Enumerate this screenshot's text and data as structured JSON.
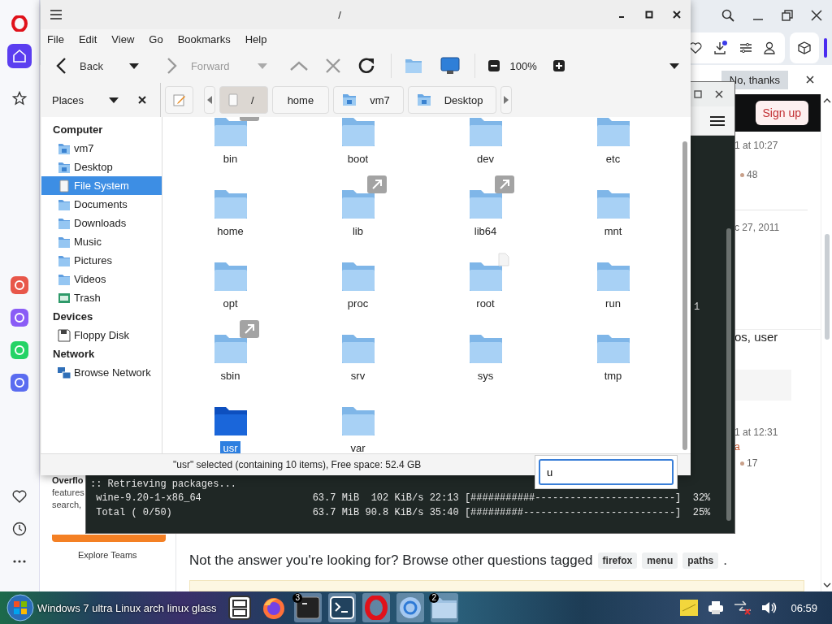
{
  "browser": {
    "sidebar": [
      {
        "kind": "logo",
        "selected": false
      },
      {
        "kind": "home",
        "selected": true
      },
      {
        "kind": "star",
        "selected": false
      },
      {
        "kind": "app-photos",
        "selected": false
      },
      {
        "kind": "app-messenger",
        "selected": false
      },
      {
        "kind": "app-whatsapp",
        "selected": false
      },
      {
        "kind": "app-music",
        "selected": false
      },
      {
        "kind": "heart",
        "selected": false
      },
      {
        "kind": "history",
        "selected": false
      },
      {
        "kind": "more",
        "selected": false
      }
    ],
    "banner": {
      "dismiss": "No, thanks"
    },
    "header": {
      "signup": "Sign up"
    },
    "side_fragments": [
      {
        "kind": "meta",
        "text": "1 at 10:27"
      },
      {
        "kind": "score",
        "text": "48"
      },
      {
        "kind": "meta",
        "text": "c 27, 2011"
      },
      {
        "kind": "title",
        "text": "os, user"
      },
      {
        "kind": "meta",
        "text": "1 at 12:31"
      },
      {
        "kind": "author",
        "text": "a"
      },
      {
        "kind": "score",
        "text": "17"
      }
    ],
    "promo": {
      "lines": [
        "Overflo",
        "features",
        "search,"
      ],
      "link": "Explore Teams"
    },
    "footer_question": {
      "text": "Not the answer you're looking for? Browse other questions tagged",
      "tags": [
        "firefox",
        "menu",
        "paths"
      ],
      "end": "."
    }
  },
  "terminal": {
    "fragment": "1",
    "lines": [
      ":: Retrieving packages...",
      " wine-9.20-1-x86_64                   63.7 MiB  102 KiB/s 22:13 [###########------------------------]  32%",
      " Total ( 0/50)                        63.7 MiB 90.8 KiB/s 35:40 [#########--------------------------]  25%"
    ]
  },
  "file_manager": {
    "title": "/",
    "menu": [
      "File",
      "Edit",
      "View",
      "Go",
      "Bookmarks",
      "Help"
    ],
    "toolbar": {
      "back": "Back",
      "forward": "Forward",
      "forward_disabled": true,
      "zoom": "100%"
    },
    "places_label": "Places",
    "path": [
      {
        "label": "/",
        "kind": "root",
        "selected": true
      },
      {
        "label": "home",
        "kind": "plain",
        "selected": false
      },
      {
        "label": "vm7",
        "kind": "home",
        "selected": false
      },
      {
        "label": "Desktop",
        "kind": "desktop",
        "selected": false
      }
    ],
    "sidebar": [
      {
        "heading": "Computer",
        "items": [
          {
            "label": "vm7",
            "kind": "home",
            "selected": false
          },
          {
            "label": "Desktop",
            "kind": "desktop",
            "selected": false
          },
          {
            "label": "File System",
            "kind": "filesystem",
            "selected": true
          },
          {
            "label": "Documents",
            "kind": "folder",
            "selected": false
          },
          {
            "label": "Downloads",
            "kind": "folder",
            "selected": false
          },
          {
            "label": "Music",
            "kind": "folder",
            "selected": false
          },
          {
            "label": "Pictures",
            "kind": "folder",
            "selected": false
          },
          {
            "label": "Videos",
            "kind": "folder",
            "selected": false
          },
          {
            "label": "Trash",
            "kind": "trash",
            "selected": false
          }
        ]
      },
      {
        "heading": "Devices",
        "items": [
          {
            "label": "Floppy Disk",
            "kind": "floppy",
            "selected": false
          }
        ]
      },
      {
        "heading": "Network",
        "items": [
          {
            "label": "Browse Network",
            "kind": "network",
            "selected": false
          }
        ]
      }
    ],
    "files": [
      {
        "name": "bin",
        "kind": "symlink",
        "selected": false
      },
      {
        "name": "boot",
        "kind": "folder",
        "selected": false
      },
      {
        "name": "dev",
        "kind": "folder",
        "selected": false
      },
      {
        "name": "etc",
        "kind": "folder",
        "selected": false
      },
      {
        "name": "home",
        "kind": "folder",
        "selected": false
      },
      {
        "name": "lib",
        "kind": "symlink",
        "selected": false
      },
      {
        "name": "lib64",
        "kind": "symlink",
        "selected": false
      },
      {
        "name": "mnt",
        "kind": "folder",
        "selected": false
      },
      {
        "name": "opt",
        "kind": "folder",
        "selected": false
      },
      {
        "name": "proc",
        "kind": "folder",
        "selected": false
      },
      {
        "name": "root",
        "kind": "restricted",
        "selected": false
      },
      {
        "name": "run",
        "kind": "folder",
        "selected": false
      },
      {
        "name": "sbin",
        "kind": "symlink",
        "selected": false
      },
      {
        "name": "srv",
        "kind": "folder",
        "selected": false
      },
      {
        "name": "sys",
        "kind": "folder",
        "selected": false
      },
      {
        "name": "tmp",
        "kind": "folder",
        "selected": false
      },
      {
        "name": "usr",
        "kind": "folder",
        "selected": true
      },
      {
        "name": "var",
        "kind": "folder",
        "selected": false
      }
    ],
    "status": "\"usr\" selected (containing 10 items), Free space: 52.4 GB",
    "typeahead": {
      "value": "u"
    }
  },
  "taskbar": {
    "start_label": "Windows 7 ultra Linux arch linux glass",
    "apps": [
      {
        "kind": "files"
      },
      {
        "kind": "firefox"
      },
      {
        "kind": "terminal",
        "badge": "3"
      },
      {
        "kind": "prompt"
      },
      {
        "kind": "opera"
      },
      {
        "kind": "chromium"
      },
      {
        "kind": "folder",
        "badge": "2"
      }
    ],
    "clock": "06:59"
  }
}
